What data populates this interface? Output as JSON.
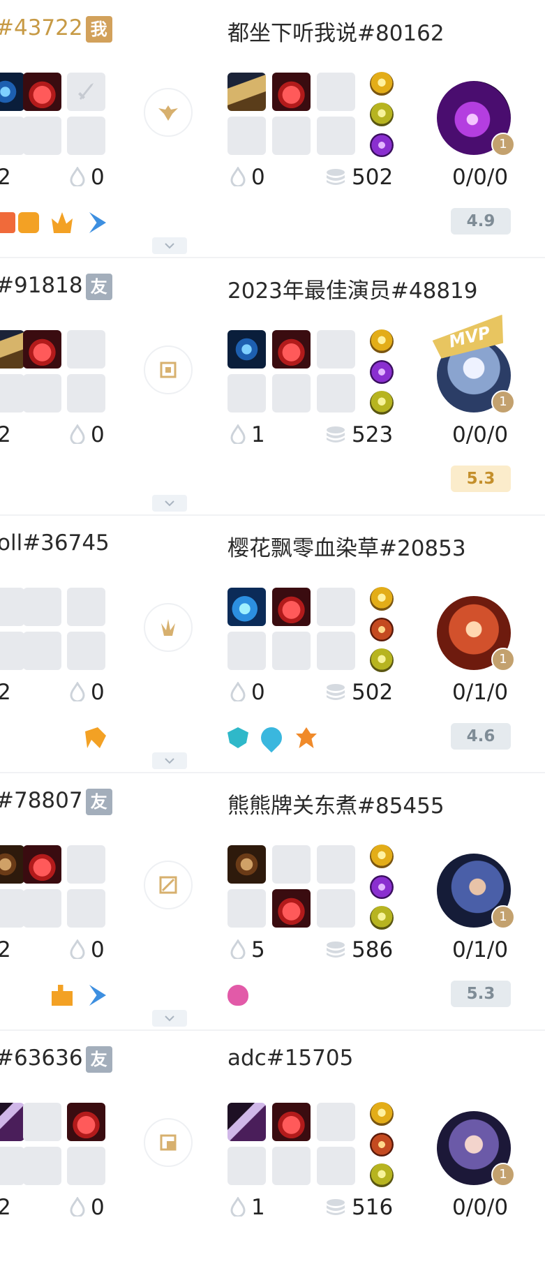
{
  "rows": [
    {
      "left_name": "#43722",
      "left_tag": "我",
      "left_stats": {
        "a": "2",
        "b": "0"
      },
      "right_name": "都坐下听我说#80162",
      "right_stats": {
        "wards": "0",
        "gold": "502",
        "kda": "0/0/0"
      },
      "score": "4.9",
      "score_style": "grey",
      "level": "1",
      "mvp": false,
      "role_icon": "support-role-icon"
    },
    {
      "left_name": "#91818",
      "left_tag": "友",
      "left_stats": {
        "a": "2",
        "b": "0"
      },
      "right_name": "2023年最佳演员#48819",
      "right_stats": {
        "wards": "1",
        "gold": "523",
        "kda": "0/0/0"
      },
      "score": "5.3",
      "score_style": "gold",
      "level": "1",
      "mvp": true,
      "mvp_label": "MVP",
      "role_icon": "jungle-square-icon"
    },
    {
      "left_name": "oll#36745",
      "left_tag": "",
      "left_stats": {
        "a": "2",
        "b": "0"
      },
      "right_name": "樱花飘零血染草#20853",
      "right_stats": {
        "wards": "0",
        "gold": "502",
        "kda": "0/1/0"
      },
      "score": "4.6",
      "score_style": "grey",
      "level": "1",
      "mvp": false,
      "role_icon": "jungle-claw-icon"
    },
    {
      "left_name": "#78807",
      "left_tag": "友",
      "left_stats": {
        "a": "2",
        "b": "0"
      },
      "right_name": "熊熊牌关东煮#85455",
      "right_stats": {
        "wards": "5",
        "gold": "586",
        "kda": "0/1/0"
      },
      "score": "5.3",
      "score_style": "grey",
      "level": "1",
      "mvp": false,
      "role_icon": "top-lane-icon"
    },
    {
      "left_name": "#63636",
      "left_tag": "友",
      "left_stats": {
        "a": "2",
        "b": "0"
      },
      "right_name": "adc#15705",
      "right_stats": {
        "wards": "1",
        "gold": "516",
        "kda": "0/0/0"
      },
      "score": "",
      "score_style": "grey",
      "level": "1",
      "mvp": false,
      "role_icon": "bottom-lane-icon"
    }
  ],
  "colors": {
    "accent_gold": "#c79a45",
    "score_gold_bg": "#fbeccb",
    "score_grey_bg": "#e5eaee",
    "tag_gold": "#d2a15b",
    "tag_grey": "#a3aebb"
  }
}
